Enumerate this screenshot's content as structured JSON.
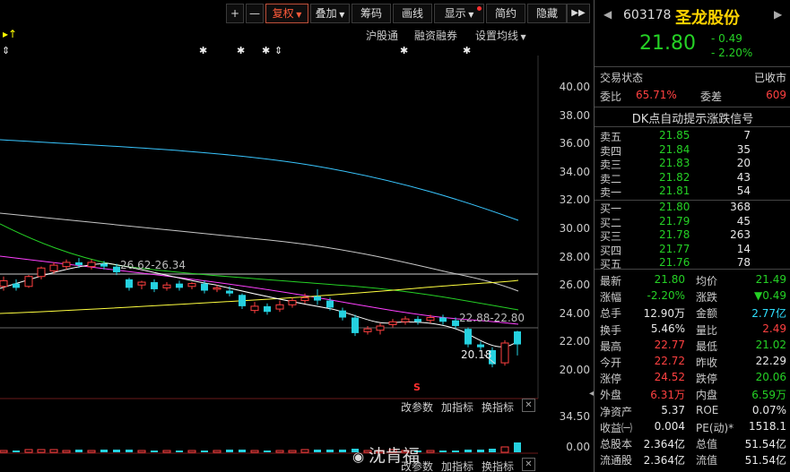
{
  "toolbar": {
    "plus": "+",
    "minus": "—",
    "fuquan": "复权",
    "diejia": "叠加",
    "chouma": "筹码",
    "huaxian": "画线",
    "xianshi": "显示",
    "jianjie": "简约",
    "yincang": "隐藏"
  },
  "chart_links": {
    "hugutong": "沪股通",
    "rongzi": "融资融券",
    "shezhi": "设置均线"
  },
  "price_axis": [
    "40.00",
    "38.00",
    "36.00",
    "34.00",
    "32.00",
    "30.00",
    "28.00",
    "26.00",
    "24.00",
    "22.00",
    "20.00"
  ],
  "annotations": {
    "ma_label_1": "26.62-26.34",
    "ma_label_2": "22.88-22.80",
    "low_label": "20.18",
    "s_marker": "S"
  },
  "volume": {
    "axis_top": "34.50",
    "axis_bottom": "0.00",
    "links": [
      "改参数",
      "加指标",
      "换指标"
    ],
    "close": "✕"
  },
  "watermark": "沈肯福",
  "stock": {
    "code": "603178",
    "name": "圣龙股份",
    "price": "21.80",
    "change": "- 0.49",
    "change_pct": "- 2.20%"
  },
  "status": {
    "label": "交易状态",
    "value": "已收市"
  },
  "weibi": {
    "label": "委比",
    "value": "65.71%",
    "label2": "委差",
    "value2": "609"
  },
  "dk_banner": "DK点自动提示涨跌信号",
  "asks": [
    {
      "label": "卖五",
      "price": "21.85",
      "vol": "7"
    },
    {
      "label": "卖四",
      "price": "21.84",
      "vol": "35"
    },
    {
      "label": "卖三",
      "price": "21.83",
      "vol": "20"
    },
    {
      "label": "卖二",
      "price": "21.82",
      "vol": "43"
    },
    {
      "label": "卖一",
      "price": "21.81",
      "vol": "54"
    }
  ],
  "bids": [
    {
      "label": "买一",
      "price": "21.80",
      "vol": "368"
    },
    {
      "label": "买二",
      "price": "21.79",
      "vol": "45"
    },
    {
      "label": "买三",
      "price": "21.78",
      "vol": "263"
    },
    {
      "label": "买四",
      "price": "21.77",
      "vol": "14"
    },
    {
      "label": "买五",
      "price": "21.76",
      "vol": "78"
    }
  ],
  "stats": [
    {
      "l1": "最新",
      "v1": "21.80",
      "c1": "green",
      "l2": "均价",
      "v2": "21.49",
      "c2": "green"
    },
    {
      "l1": "涨幅",
      "v1": "-2.20%",
      "c1": "green",
      "l2": "涨跌",
      "v2": "▼0.49",
      "c2": "green"
    },
    {
      "l1": "总手",
      "v1": "12.90万",
      "c1": "white",
      "l2": "金额",
      "v2": "2.77亿",
      "c2": "cyan"
    },
    {
      "l1": "换手",
      "v1": "5.46%",
      "c1": "white",
      "l2": "量比",
      "v2": "2.49",
      "c2": "red"
    },
    {
      "l1": "最高",
      "v1": "22.77",
      "c1": "red",
      "l2": "最低",
      "v2": "21.02",
      "c2": "green"
    },
    {
      "l1": "今开",
      "v1": "22.72",
      "c1": "red",
      "l2": "昨收",
      "v2": "22.29",
      "c2": "white"
    },
    {
      "l1": "涨停",
      "v1": "24.52",
      "c1": "red",
      "l2": "跌停",
      "v2": "20.06",
      "c2": "green"
    },
    {
      "l1": "外盘",
      "v1": "6.31万",
      "c1": "red",
      "l2": "内盘",
      "v2": "6.59万",
      "c2": "green"
    },
    {
      "l1": "净资产",
      "v1": "5.37",
      "c1": "white",
      "l2": "ROE",
      "v2": "0.07%",
      "c2": "white"
    },
    {
      "l1": "收益㈠",
      "v1": "0.004",
      "c1": "white",
      "l2": "PE(动)*",
      "v2": "1518.1",
      "c2": "white"
    },
    {
      "l1": "总股本",
      "v1": "2.364亿",
      "c1": "white",
      "l2": "总值",
      "v2": "51.54亿",
      "c2": "white"
    },
    {
      "l1": "流通股",
      "v1": "2.364亿",
      "c1": "white",
      "l2": "流值",
      "v2": "51.54亿",
      "c2": "white"
    }
  ],
  "colors": {
    "up": "#ff4040",
    "down": "#25d1e0",
    "ma5": "#ffffff",
    "ma10": "#ffff40",
    "ma20": "#ff40ff",
    "ma30": "#25d125",
    "ma60": "#c8c8c8",
    "ma120": "#39c6ff"
  }
}
